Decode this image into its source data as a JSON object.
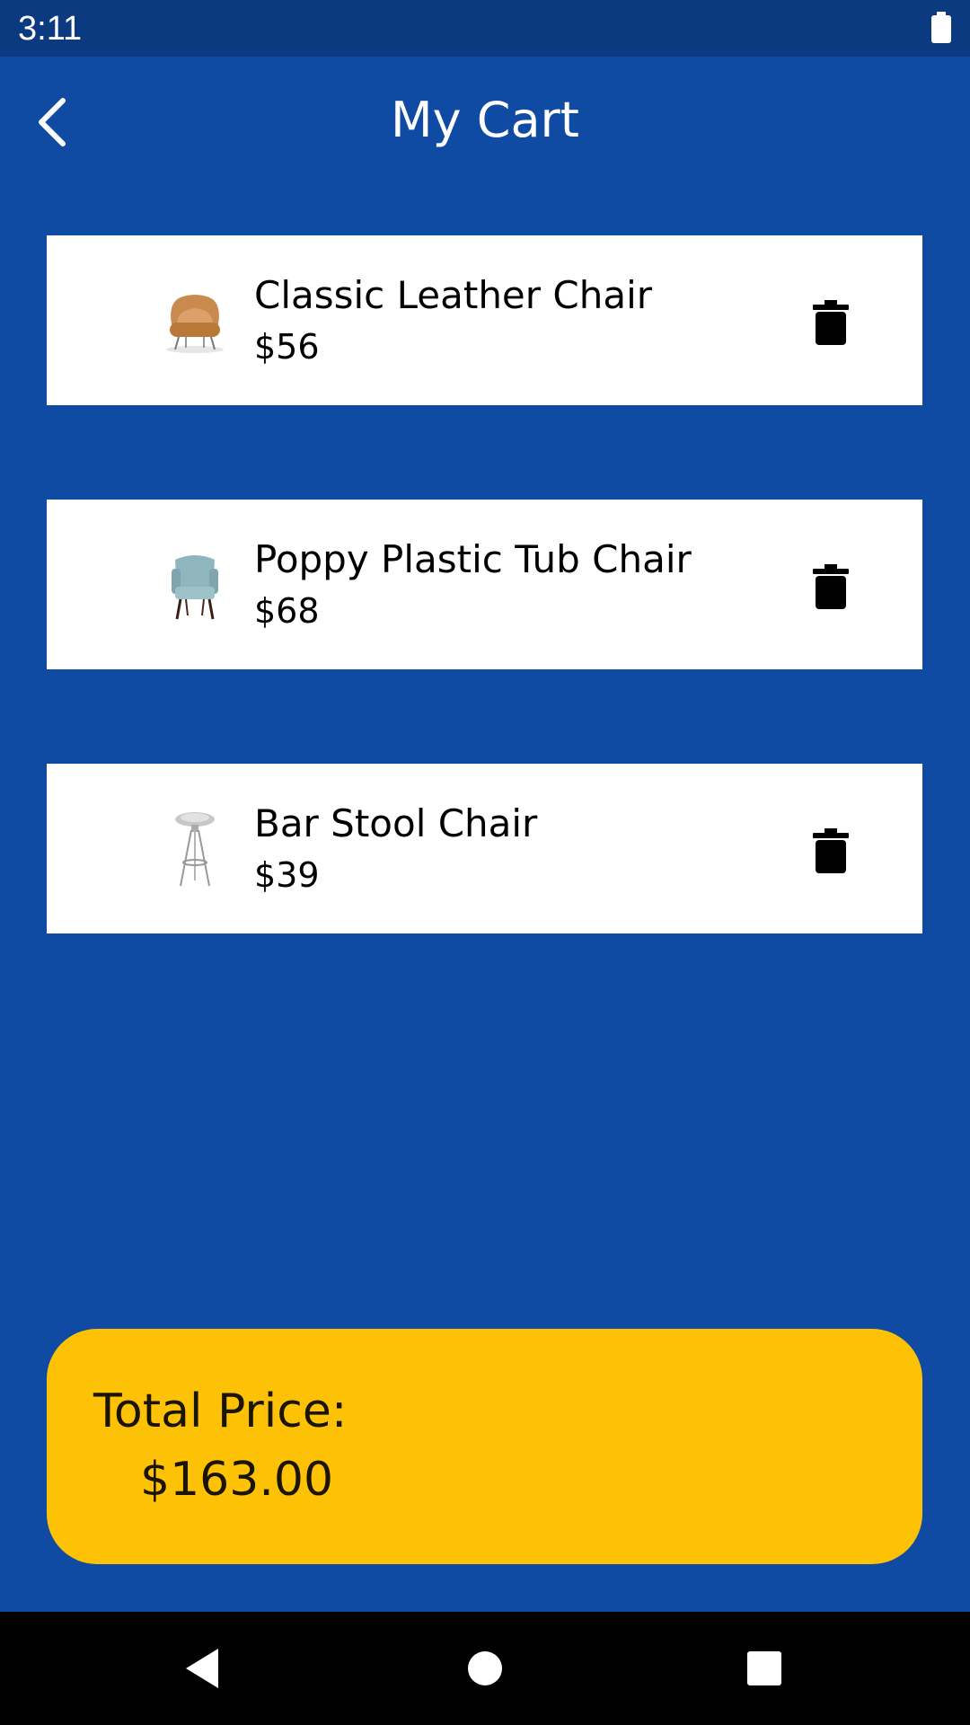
{
  "status_bar": {
    "time": "3:11",
    "battery_icon": "battery-full-icon"
  },
  "header": {
    "back_icon": "chevron-left-icon",
    "title": "My Cart"
  },
  "cart": {
    "items": [
      {
        "name": "Classic Leather Chair",
        "price": "$56",
        "thumbnail": "leather-armchair-image",
        "delete_icon": "trash-icon"
      },
      {
        "name": "Poppy Plastic Tub Chair",
        "price": "$68",
        "thumbnail": "tub-chair-image",
        "delete_icon": "trash-icon"
      },
      {
        "name": "Bar Stool Chair",
        "price": "$39",
        "thumbnail": "bar-stool-image",
        "delete_icon": "trash-icon"
      }
    ]
  },
  "total": {
    "label": "Total Price:",
    "value": "$163.00"
  },
  "nav_bar": {
    "back": "triangle-back-icon",
    "home": "circle-home-icon",
    "recents": "square-recents-icon"
  },
  "colors": {
    "background": "#0f4aa3",
    "status_bar": "#0b3a80",
    "card": "#ffffff",
    "total_card": "#fdc106",
    "nav_bar": "#000000"
  }
}
